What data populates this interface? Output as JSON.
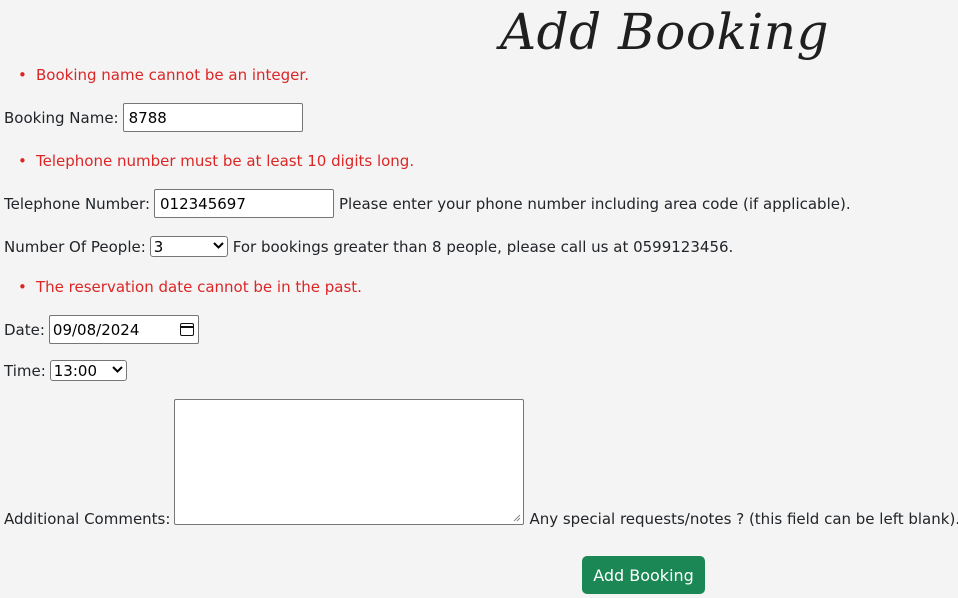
{
  "page": {
    "title": "Add Booking"
  },
  "errors": {
    "booking_name": "Booking name cannot be an integer.",
    "telephone": "Telephone number must be at least 10 digits long.",
    "date": "The reservation date cannot be in the past."
  },
  "form": {
    "booking_name": {
      "label": "Booking Name:",
      "value": "8788"
    },
    "telephone": {
      "label": "Telephone Number:",
      "value": "012345697",
      "help": "Please enter your phone number including area code (if applicable)."
    },
    "people": {
      "label": "Number Of People:",
      "selected": "3",
      "help": "For bookings greater than 8 people, please call us at 0599123456."
    },
    "date": {
      "label": "Date:",
      "value": "09/08/2024"
    },
    "time": {
      "label": "Time:",
      "selected": "13:00"
    },
    "comments": {
      "label": "Additional Comments:",
      "value": "",
      "help": "Any special requests/notes ? (this field can be left blank)."
    },
    "submit_label": "Add Booking"
  },
  "colors": {
    "error": "#dc2626",
    "button": "#1a8754",
    "background": "#f4f4f4"
  },
  "icons": {
    "date_picker": "calendar-icon",
    "select_arrow": "chevron-down-icon"
  }
}
